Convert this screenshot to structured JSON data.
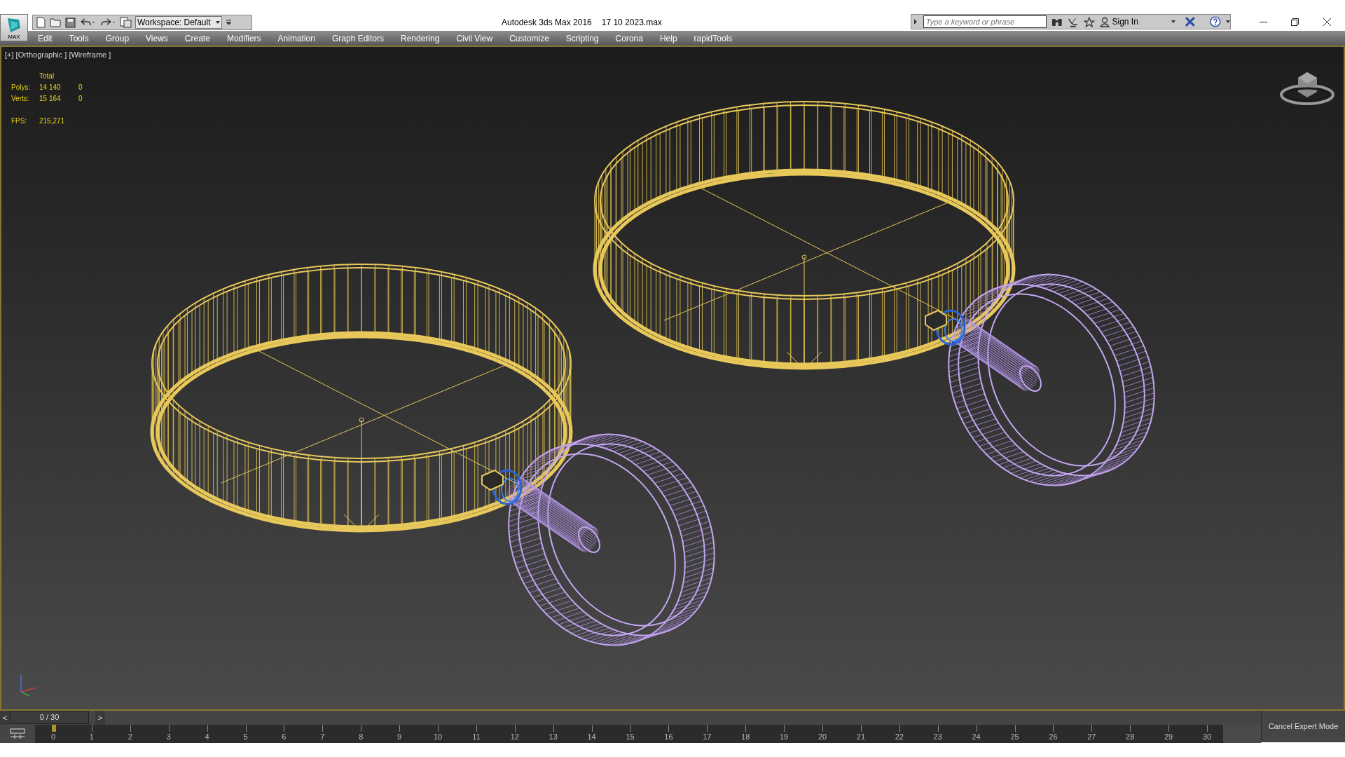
{
  "window": {
    "title": "Autodesk 3ds Max 2016",
    "file": "17 10 2023.max"
  },
  "app_button": {
    "label": "MAX"
  },
  "toolbar": {
    "workspace": "Workspace: Default"
  },
  "infocenter": {
    "search": {
      "placeholder": "Type a keyword or phrase"
    },
    "sign_in": "Sign In"
  },
  "menu": [
    "Edit",
    "Tools",
    "Group",
    "Views",
    "Create",
    "Modifiers",
    "Animation",
    "Graph Editors",
    "Rendering",
    "Civil View",
    "Customize",
    "Scripting",
    "Corona",
    "Help",
    "rapidTools"
  ],
  "viewport": {
    "label": "[+] [Orthographic ] [Wireframe ]",
    "stats": {
      "header": "Total",
      "rows": [
        {
          "label": "Polys:",
          "total": "14 140",
          "selected": "0"
        },
        {
          "label": "Verts:",
          "total": "15 164",
          "selected": "0"
        }
      ],
      "fps": {
        "label": "FPS:",
        "value": "215,271"
      }
    }
  },
  "time_slider": {
    "prev": "<",
    "next": ">",
    "reading": "0 / 30",
    "level": 0
  },
  "track_bar": {
    "ticks": [
      "0",
      "1",
      "2",
      "3",
      "4",
      "5",
      "6",
      "7",
      "8",
      "9",
      "10",
      "11",
      "12",
      "13",
      "14",
      "15",
      "16",
      "17",
      "18",
      "19",
      "20",
      "21",
      "22",
      "23",
      "24",
      "25",
      "26",
      "27",
      "28",
      "29",
      "30"
    ]
  },
  "cancel_button": "Cancel Expert Mode"
}
